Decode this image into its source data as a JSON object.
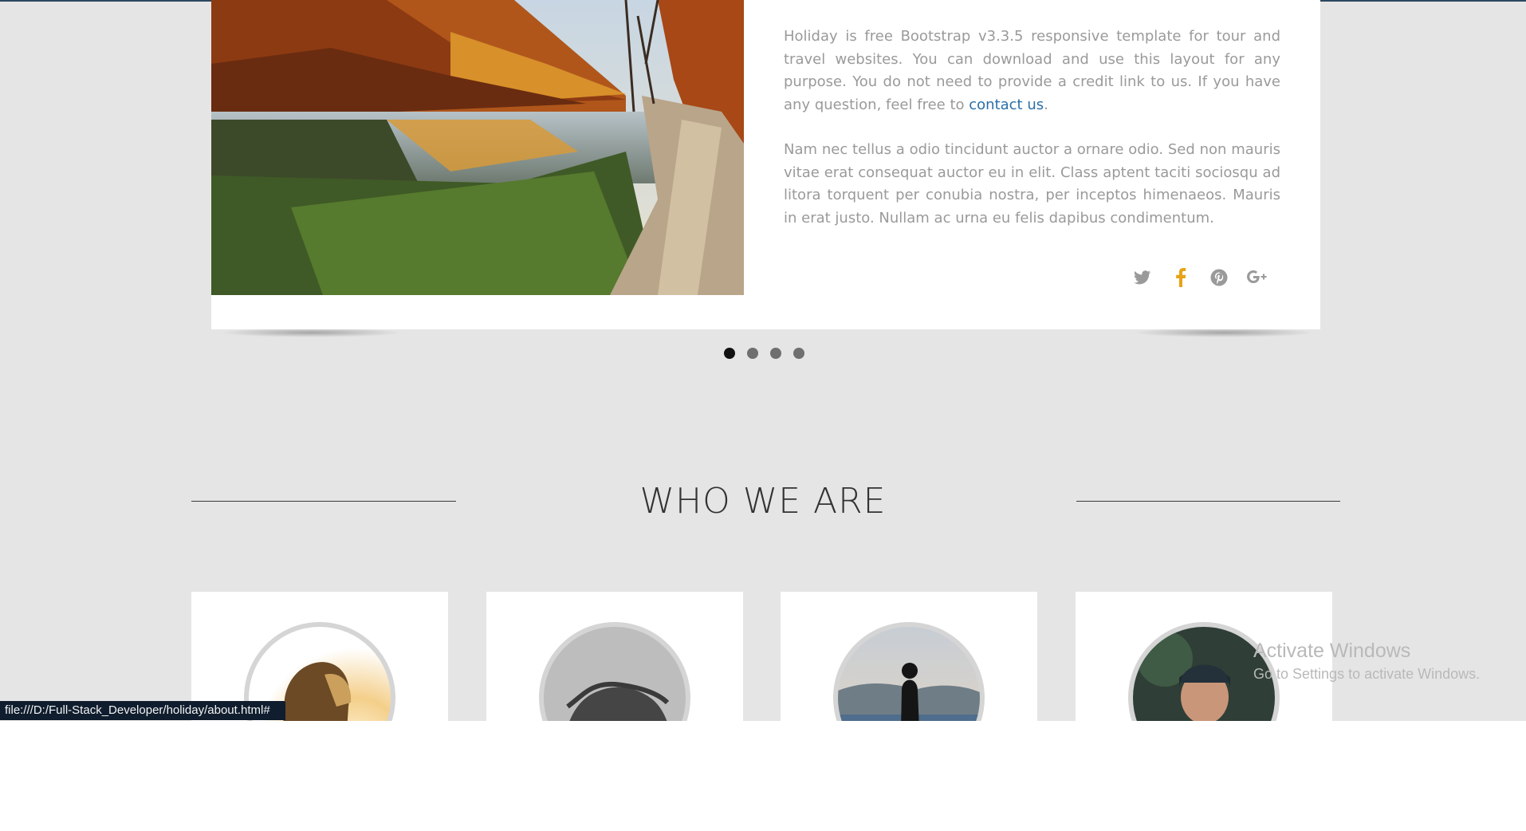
{
  "slider": {
    "paragraph_1": "Holiday is free Bootstrap v3.3.5 responsive template for tour and travel websites. You can download and use this layout for any purpose. You do not need to provide a credit link to us. If you have any question, feel free to",
    "contact_link": "contact us",
    "paragraph_1_end": ".",
    "paragraph_2": "Nam nec tellus a odio tincidunt auctor a ornare odio. Sed non mauris vitae erat consequat auctor eu in elit. Class aptent taciti sociosqu ad litora torquent per conubia nostra, per inceptos himenaeos. Mauris in erat justo. Nullam ac urna eu felis dapibus condimentum.",
    "social_icons": [
      "twitter-icon",
      "facebook-icon",
      "pinterest-icon",
      "google-plus-icon"
    ],
    "active_social_color": "#e8a317",
    "dots_count": 4,
    "active_dot": 1
  },
  "section": {
    "title": "WHO WE ARE"
  },
  "team": [
    {
      "photo": "person-sunlight"
    },
    {
      "photo": "person-hair-bw"
    },
    {
      "photo": "person-lake"
    },
    {
      "photo": "person-beanie"
    }
  ],
  "status_bar": {
    "url": "file:///D:/Full-Stack_Developer/holiday/about.html#"
  },
  "watermark": {
    "title": "Activate Windows",
    "subtitle": "Go to Settings to activate Windows."
  },
  "colors": {
    "page_bg": "#e5e5e5",
    "link": "#2a6fa8",
    "text_muted": "#9a9a9a",
    "heading": "#333333"
  }
}
